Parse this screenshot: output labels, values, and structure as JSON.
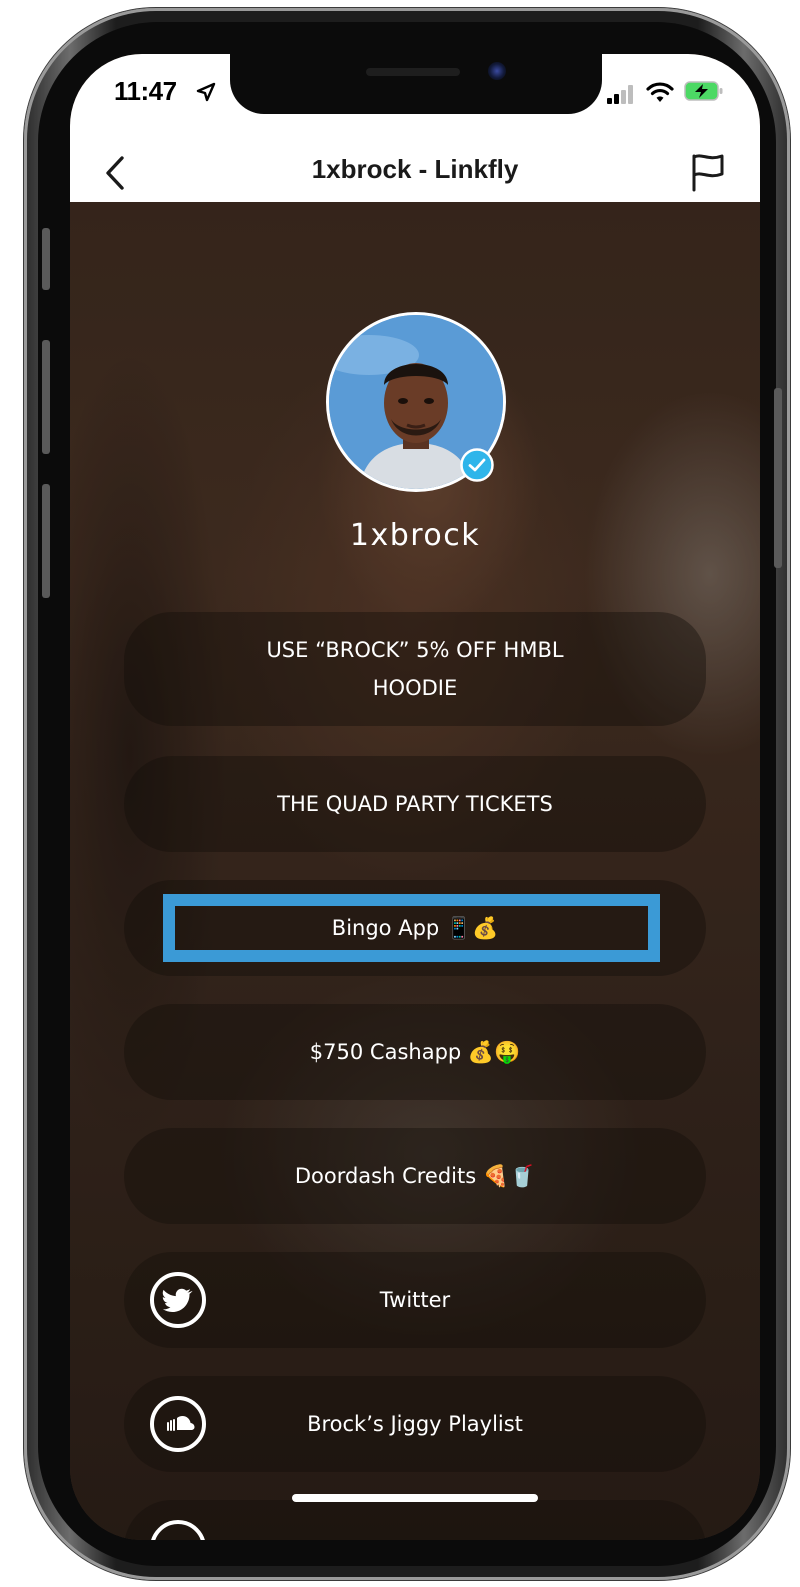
{
  "status_bar": {
    "time": "11:47",
    "icons": [
      "location-arrow-icon",
      "cellular-signal-icon",
      "wifi-icon",
      "battery-charging-icon"
    ]
  },
  "nav": {
    "title": "1xbrock - Linkfly",
    "back_icon": "chevron-left-icon",
    "report_icon": "flag-icon"
  },
  "profile": {
    "username": "1xbrock",
    "verified_icon": "verified-check-icon"
  },
  "links": [
    {
      "label": "USE “BROCK” 5% OFF HMBL HOODIE"
    },
    {
      "label": "THE QUAD PARTY TICKETS"
    },
    {
      "label": "Bingo App 📱💰"
    },
    {
      "label": "$750 Cashapp 💰🤑"
    },
    {
      "label": "Doordash Credits 🍕🥤"
    },
    {
      "label": "Twitter",
      "icon": "twitter-icon"
    },
    {
      "label": "Brock’s Jiggy Playlist",
      "icon": "soundcloud-icon"
    },
    {
      "label": "",
      "icon": "circle-icon"
    }
  ],
  "highlight": {
    "target": "Bingo App 📱💰",
    "color": "#3b9ad6"
  },
  "colors": {
    "accent": "#3b9ad6",
    "verified": "#2fb5ea"
  }
}
